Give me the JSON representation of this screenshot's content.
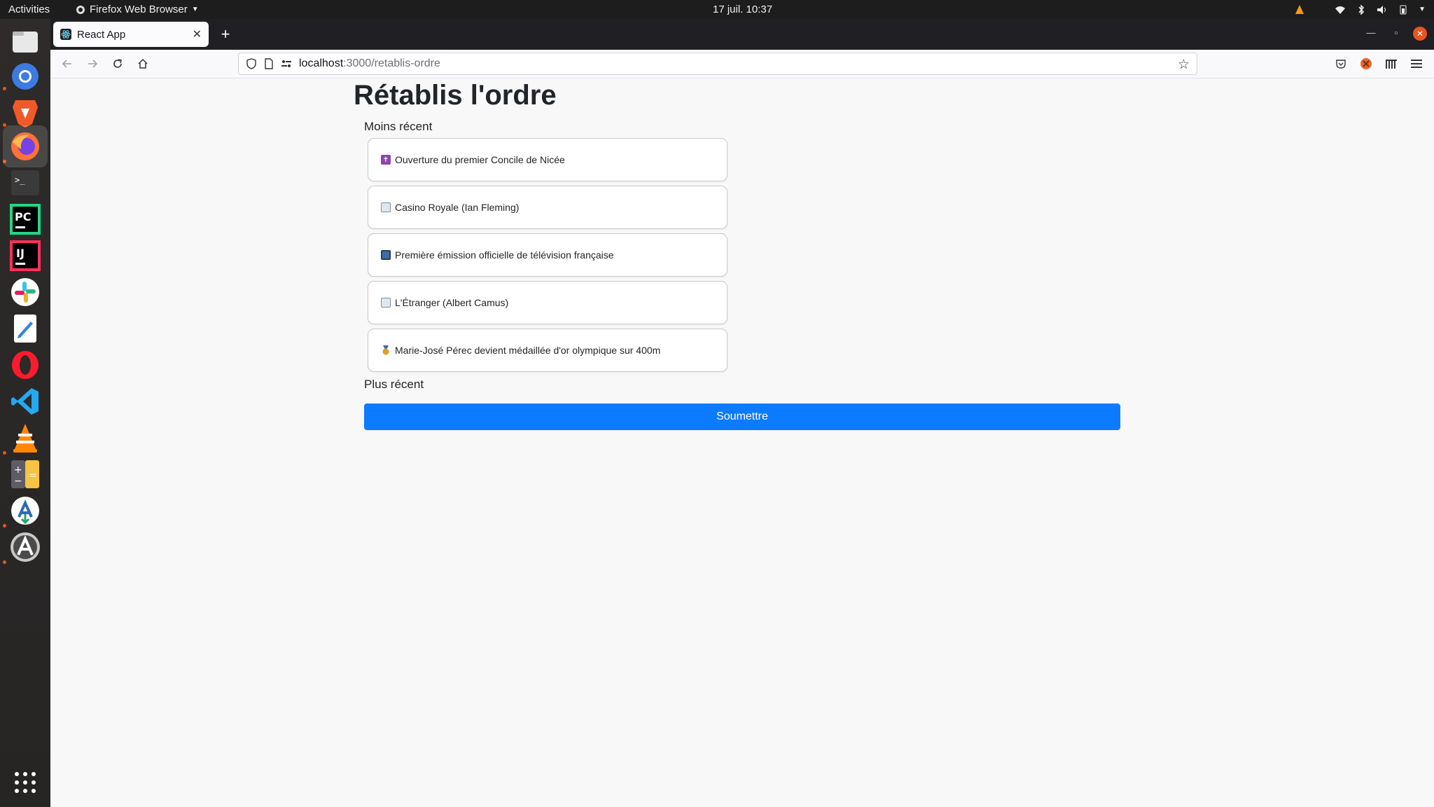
{
  "system_bar": {
    "activities": "Activities",
    "app_name": "Firefox Web Browser",
    "clock": "17 juil.  10:37"
  },
  "browser": {
    "tab_title": "React App",
    "url_host": "localhost",
    "url_path": ":3000/retablis-ordre"
  },
  "page": {
    "title": "Rétablis l'ordre",
    "top_label": "Moins récent",
    "bottom_label": "Plus récent",
    "events": [
      {
        "icon": "latin-cross-icon",
        "icon_color": "#8e44ad",
        "label": "Ouverture du premier Concile de Nicée"
      },
      {
        "icon": "book-icon",
        "icon_color": "#7a8fa6",
        "label": "Casino Royale (Ian Fleming)"
      },
      {
        "icon": "television-icon",
        "icon_color": "#3b6ea5",
        "label": "Première émission officielle de télévision française"
      },
      {
        "icon": "book-icon",
        "icon_color": "#7a8fa6",
        "label": "L'Étranger (Albert Camus)"
      },
      {
        "icon": "medal-icon",
        "icon_color": "#e0a020",
        "label": "Marie-José Pérec devient médaillée d'or olympique sur 400m"
      }
    ],
    "submit_label": "Soumettre"
  },
  "colors": {
    "accent": "#0d7bff",
    "dock_indicator": "#e95420"
  }
}
